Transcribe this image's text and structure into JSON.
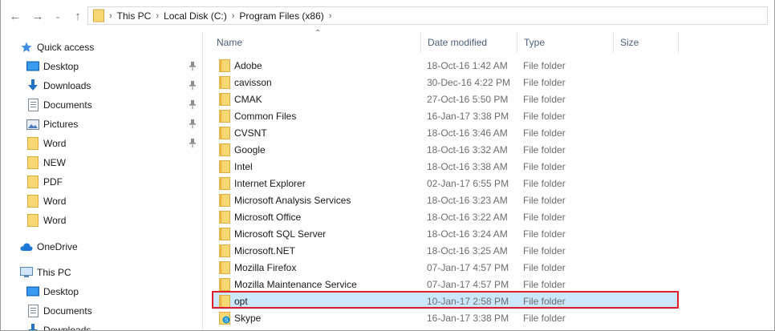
{
  "address": {
    "crumbs": [
      "This PC",
      "Local Disk (C:)",
      "Program Files (x86)"
    ]
  },
  "nav": {
    "quick_access": "Quick access",
    "items": [
      {
        "label": "Desktop",
        "icon": "desktop-icon",
        "pinned": true
      },
      {
        "label": "Downloads",
        "icon": "download-icon",
        "pinned": true
      },
      {
        "label": "Documents",
        "icon": "documents-icon",
        "pinned": true
      },
      {
        "label": "Pictures",
        "icon": "pictures-icon",
        "pinned": true
      },
      {
        "label": "Word",
        "icon": "folder-icon",
        "pinned": true
      },
      {
        "label": "NEW",
        "icon": "folder-icon",
        "pinned": false
      },
      {
        "label": "PDF",
        "icon": "folder-icon",
        "pinned": false
      },
      {
        "label": "Word",
        "icon": "folder-icon",
        "pinned": false
      },
      {
        "label": "Word",
        "icon": "folder-icon",
        "pinned": false
      }
    ],
    "onedrive": "OneDrive",
    "this_pc": "This PC",
    "pc_items": [
      {
        "label": "Desktop",
        "icon": "desktop-icon"
      },
      {
        "label": "Documents",
        "icon": "documents-icon"
      },
      {
        "label": "Downloads",
        "icon": "download-icon"
      }
    ]
  },
  "columns": {
    "name": "Name",
    "date": "Date modified",
    "type": "Type",
    "size": "Size"
  },
  "files": [
    {
      "name": "Adobe",
      "date": "18-Oct-16 1:42 AM",
      "type": "File folder"
    },
    {
      "name": "cavisson",
      "date": "30-Dec-16 4:22 PM",
      "type": "File folder"
    },
    {
      "name": "CMAK",
      "date": "27-Oct-16 5:50 PM",
      "type": "File folder"
    },
    {
      "name": "Common Files",
      "date": "16-Jan-17 3:38 PM",
      "type": "File folder"
    },
    {
      "name": "CVSNT",
      "date": "18-Oct-16 3:46 AM",
      "type": "File folder"
    },
    {
      "name": "Google",
      "date": "18-Oct-16 3:32 AM",
      "type": "File folder"
    },
    {
      "name": "Intel",
      "date": "18-Oct-16 3:38 AM",
      "type": "File folder"
    },
    {
      "name": "Internet Explorer",
      "date": "02-Jan-17 6:55 PM",
      "type": "File folder"
    },
    {
      "name": "Microsoft Analysis Services",
      "date": "18-Oct-16 3:23 AM",
      "type": "File folder"
    },
    {
      "name": "Microsoft Office",
      "date": "18-Oct-16 3:22 AM",
      "type": "File folder"
    },
    {
      "name": "Microsoft SQL Server",
      "date": "18-Oct-16 3:24 AM",
      "type": "File folder"
    },
    {
      "name": "Microsoft.NET",
      "date": "18-Oct-16 3:25 AM",
      "type": "File folder"
    },
    {
      "name": "Mozilla Firefox",
      "date": "07-Jan-17 4:57 PM",
      "type": "File folder"
    },
    {
      "name": "Mozilla Maintenance Service",
      "date": "07-Jan-17 4:57 PM",
      "type": "File folder"
    },
    {
      "name": "opt",
      "date": "10-Jan-17 2:58 PM",
      "type": "File folder",
      "selected": true
    },
    {
      "name": "Skype",
      "date": "16-Jan-17 3:38 PM",
      "type": "File folder",
      "icon": "skype-folder-icon"
    }
  ],
  "colors": {
    "selection": "#cce8ff",
    "highlight": "#e01e2b",
    "folder": "#f8d775"
  }
}
